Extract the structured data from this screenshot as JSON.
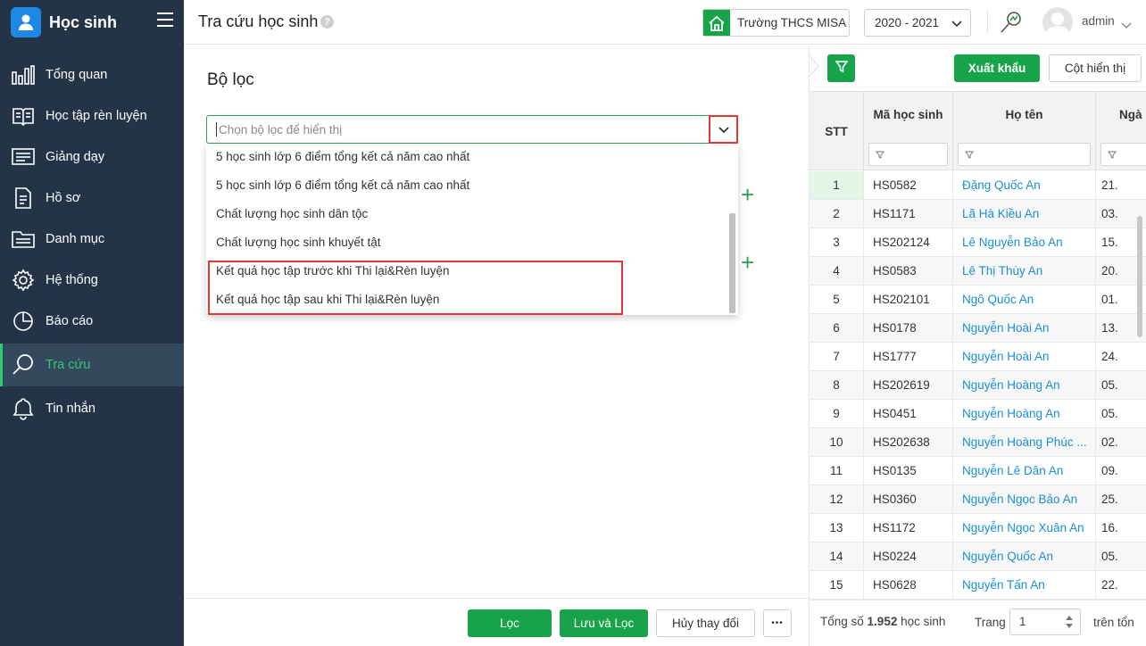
{
  "app": {
    "title": "Học sinh"
  },
  "sidebar": {
    "items": [
      {
        "label": "Tổng quan",
        "icon": "chart-bars-icon"
      },
      {
        "label": "Học tập rèn luyện",
        "icon": "book-icon"
      },
      {
        "label": "Giảng dạy",
        "icon": "board-icon"
      },
      {
        "label": "Hồ sơ",
        "icon": "document-icon"
      },
      {
        "label": "Danh mục",
        "icon": "folder-icon"
      },
      {
        "label": "Hệ thống",
        "icon": "gear-icon"
      },
      {
        "label": "Báo cáo",
        "icon": "pie-chart-icon"
      },
      {
        "label": "Tra cứu",
        "icon": "search-icon",
        "active": true
      },
      {
        "label": "Tin nhắn",
        "icon": "bell-icon"
      }
    ]
  },
  "header": {
    "page_title": "Tra cứu học sinh",
    "help": "?",
    "school": "Trường THCS MISA",
    "year": "2020 - 2021",
    "user": "admin"
  },
  "filter": {
    "title": "Bộ lọc",
    "placeholder": "Chọn bộ lọc để hiển thị",
    "options": [
      "5 học sinh lớp 6 điểm tổng kết cả năm cao nhất",
      "5 học sinh lớp 6 điểm tổng kết cả năm cao nhất",
      "Chất lượng học sinh dân tộc",
      "Chất lượng học sinh khuyết tật",
      "Kết quả học tập trước khi Thi lại&Rèn luyện",
      "Kết quả học tập sau khi Thi lại&Rèn luyện"
    ]
  },
  "actions": {
    "filter": "Lọc",
    "save_filter": "Lưu và Lọc",
    "cancel": "Hủy thay đổi",
    "more": "•••"
  },
  "grid": {
    "export": "Xuất khẩu",
    "columns_btn": "Cột hiển thị",
    "headers": {
      "stt": "STT",
      "ma": "Mã học sinh",
      "ho_ten": "Họ tên",
      "ngay": "Ngà"
    },
    "rows": [
      {
        "stt": "1",
        "ma": "HS0582",
        "ten": "Đặng Quốc An",
        "ngay": "21."
      },
      {
        "stt": "2",
        "ma": "HS1171",
        "ten": "Lã Hà Kiều An",
        "ngay": "03."
      },
      {
        "stt": "3",
        "ma": "HS202124",
        "ten": "Lê Nguyễn Bảo An",
        "ngay": "15."
      },
      {
        "stt": "4",
        "ma": "HS0583",
        "ten": "Lê Thị Thùy An",
        "ngay": "20."
      },
      {
        "stt": "5",
        "ma": "HS202101",
        "ten": "Ngô Quốc An",
        "ngay": "01."
      },
      {
        "stt": "6",
        "ma": "HS0178",
        "ten": "Nguyễn Hoài An",
        "ngay": "13."
      },
      {
        "stt": "7",
        "ma": "HS1777",
        "ten": "Nguyễn Hoài An",
        "ngay": "24."
      },
      {
        "stt": "8",
        "ma": "HS202619",
        "ten": "Nguyễn Hoàng An",
        "ngay": "05."
      },
      {
        "stt": "9",
        "ma": "HS0451",
        "ten": "Nguyễn Hoàng An",
        "ngay": "05."
      },
      {
        "stt": "10",
        "ma": "HS202638",
        "ten": "Nguyễn Hoàng Phúc ...",
        "ngay": "02."
      },
      {
        "stt": "11",
        "ma": "HS0135",
        "ten": "Nguyễn Lê Dân An",
        "ngay": "09."
      },
      {
        "stt": "12",
        "ma": "HS0360",
        "ten": "Nguyễn Ngọc Bảo An",
        "ngay": "25."
      },
      {
        "stt": "13",
        "ma": "HS1172",
        "ten": "Nguyễn Ngọc Xuân An",
        "ngay": "16."
      },
      {
        "stt": "14",
        "ma": "HS0224",
        "ten": "Nguyễn Quốc An",
        "ngay": "05."
      },
      {
        "stt": "15",
        "ma": "HS0628",
        "ten": "Nguyễn Tấn An",
        "ngay": "22."
      }
    ],
    "footer": {
      "total_prefix": "Tổng số",
      "total_count": "1.952",
      "total_suffix": "học sinh",
      "page_label": "Trang",
      "page_value": "1",
      "of_label": "trên tổn"
    }
  },
  "colors": {
    "sidebar_bg": "#243447",
    "accent": "#17a34a",
    "highlight": "#e53935",
    "link": "#1a8fd6"
  }
}
